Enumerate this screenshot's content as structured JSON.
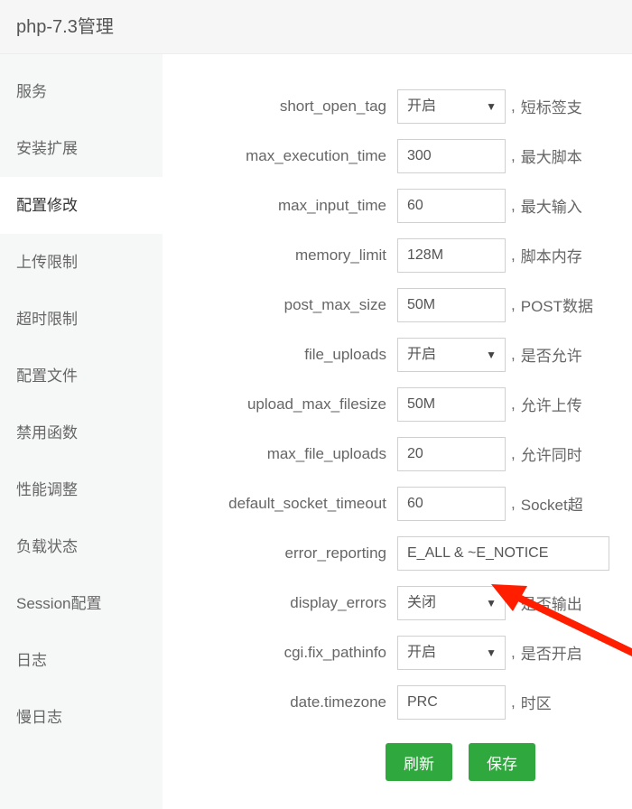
{
  "title": "php-7.3管理",
  "sidebar": {
    "items": [
      {
        "label": "服务"
      },
      {
        "label": "安装扩展"
      },
      {
        "label": "配置修改"
      },
      {
        "label": "上传限制"
      },
      {
        "label": "超时限制"
      },
      {
        "label": "配置文件"
      },
      {
        "label": "禁用函数"
      },
      {
        "label": "性能调整"
      },
      {
        "label": "负载状态"
      },
      {
        "label": "Session配置"
      },
      {
        "label": "日志"
      },
      {
        "label": "慢日志"
      }
    ],
    "active_index": 2
  },
  "select_options": {
    "open_close": [
      "开启",
      "关闭"
    ]
  },
  "settings": [
    {
      "key": "short_open_tag",
      "type": "select",
      "value": "开启",
      "desc": "短标签支"
    },
    {
      "key": "max_execution_time",
      "type": "input",
      "value": "300",
      "desc": "最大脚本"
    },
    {
      "key": "max_input_time",
      "type": "input",
      "value": "60",
      "desc": "最大输入"
    },
    {
      "key": "memory_limit",
      "type": "input",
      "value": "128M",
      "desc": "脚本内存"
    },
    {
      "key": "post_max_size",
      "type": "input",
      "value": "50M",
      "desc": "POST数据"
    },
    {
      "key": "file_uploads",
      "type": "select",
      "value": "开启",
      "desc": "是否允许"
    },
    {
      "key": "upload_max_filesize",
      "type": "input",
      "value": "50M",
      "desc": "允许上传"
    },
    {
      "key": "max_file_uploads",
      "type": "input",
      "value": "20",
      "desc": "允许同时"
    },
    {
      "key": "default_socket_timeout",
      "type": "input",
      "value": "60",
      "desc": "Socket超"
    },
    {
      "key": "error_reporting",
      "type": "input_wide",
      "value": "E_ALL & ~E_NOTICE",
      "desc": ""
    },
    {
      "key": "display_errors",
      "type": "select",
      "value": "关闭",
      "desc": "是否输出"
    },
    {
      "key": "cgi.fix_pathinfo",
      "type": "select",
      "value": "开启",
      "desc": "是否开启"
    },
    {
      "key": "date.timezone",
      "type": "input",
      "value": "PRC",
      "desc": "时区"
    }
  ],
  "buttons": {
    "refresh": "刷新",
    "save": "保存"
  },
  "comma": ","
}
